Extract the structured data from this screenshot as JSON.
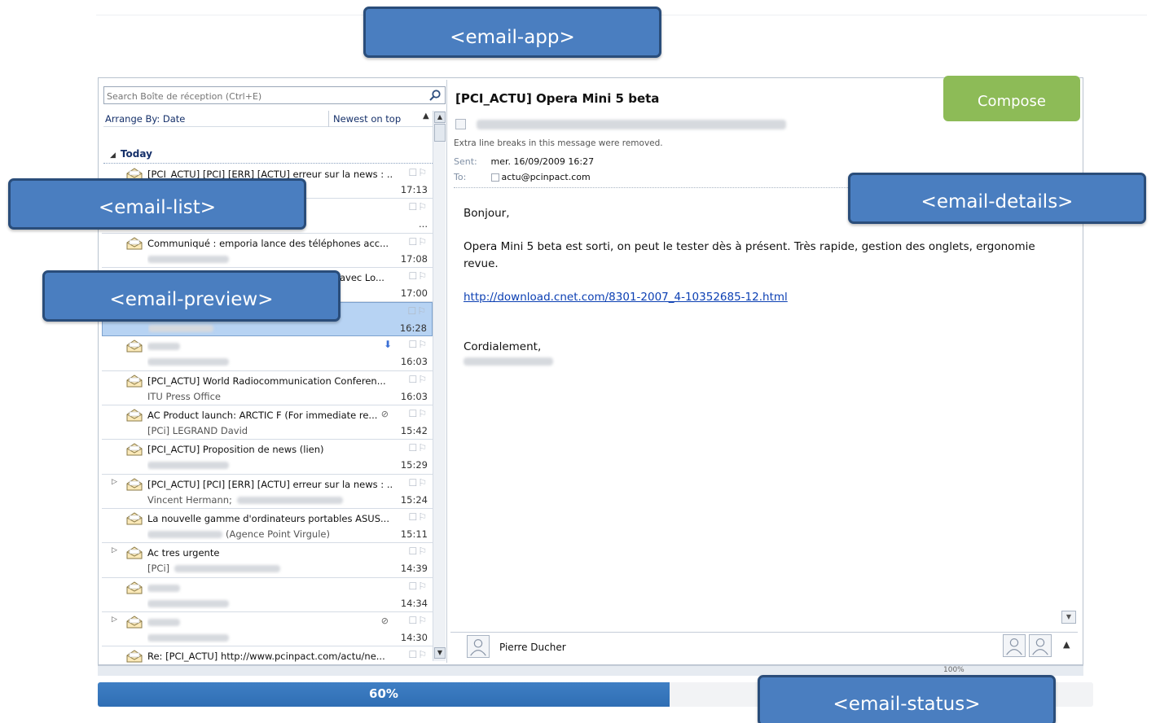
{
  "annotations": {
    "email_app": "<email-app>",
    "email_list": "<email-list>",
    "email_preview": "<email-preview>",
    "email_details": "<email-details>",
    "email_status": "<email-status>"
  },
  "compose_label": "Compose",
  "search": {
    "placeholder": "Search Boîte de réception (Ctrl+E)"
  },
  "arrange": {
    "by": "Arrange By: Date",
    "order": "Newest on top"
  },
  "group": "Today",
  "mails": [
    {
      "subject": "[PCI_ACTU] [PCI] [ERR] [ACTU] erreur sur la news : ...",
      "sender": "",
      "time": "17:13"
    },
    {
      "subject": "",
      "sender": "",
      "time": "..."
    },
    {
      "subject": "Communiqué : emporia lance des téléphones acc...",
      "sender": "",
      "time": "17:08"
    },
    {
      "subject": "avec Lo...",
      "sender": "",
      "time": "17:00"
    },
    {
      "subject": "",
      "sender": "",
      "time": "16:28"
    },
    {
      "subject": "",
      "sender": "",
      "time": "16:03"
    },
    {
      "subject": "[PCI_ACTU] World Radiocommunication Conferen...",
      "sender": "ITU Press Office",
      "time": "16:03"
    },
    {
      "subject": "AC Product launch: ARCTIC F (For immediate re...",
      "sender": "[PCi] LEGRAND David",
      "time": "15:42"
    },
    {
      "subject": "[PCI_ACTU] Proposition de news (lien)",
      "sender": "",
      "time": "15:29"
    },
    {
      "subject": "[PCI_ACTU] [PCI] [ERR] [ACTU] erreur sur la news : ...",
      "sender": "Vincent Hermann;",
      "time": "15:24"
    },
    {
      "subject": "La nouvelle gamme d'ordinateurs portables ASUS...",
      "sender": "(Agence Point Virgule)",
      "time": "15:11"
    },
    {
      "subject": "Ac tres urgente",
      "sender": "[PCi]",
      "time": "14:39"
    },
    {
      "subject": "",
      "sender": "",
      "time": "14:34"
    },
    {
      "subject": "",
      "sender": "",
      "time": "14:30"
    },
    {
      "subject": "Re: [PCI_ACTU] http://www.pcinpact.com/actu/ne...",
      "sender": "",
      "time": ""
    }
  ],
  "message": {
    "subject": "[PCI_ACTU] Opera Mini 5 beta",
    "info": "Extra line breaks in this message were removed.",
    "sent_label": "Sent:",
    "sent": "mer. 16/09/2009 16:27",
    "to_label": "To:",
    "to": "actu@pcinpact.com",
    "greeting": "Bonjour,",
    "body": "Opera Mini 5 beta est sorti, on peut le tester dès à présent. Très rapide, gestion des onglets, ergonomie revue.",
    "link": "http://download.cnet.com/8301-2007_4-10352685-12.html",
    "closing": "Cordialement,"
  },
  "people": {
    "name": "Pierre Ducher"
  },
  "status": {
    "zoom": "100%"
  },
  "progress": {
    "value": 60,
    "label": "60%"
  },
  "colors": {
    "accent": "#4a7ec0",
    "compose": "#8dbb57",
    "progress": "#2f6eb4",
    "selected": "#b7d3f3"
  }
}
